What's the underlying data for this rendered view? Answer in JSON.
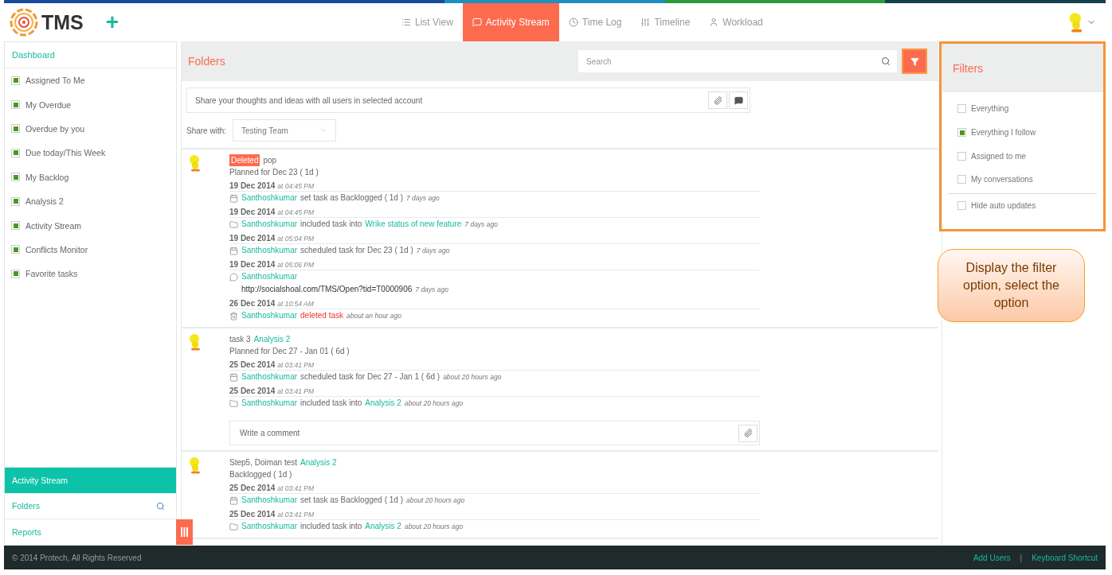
{
  "header": {
    "logo": "TMS",
    "add": "+",
    "tabs": [
      {
        "label": "List View",
        "kind": "list",
        "selected": false
      },
      {
        "label": "Activity Stream",
        "kind": "chat",
        "selected": true
      },
      {
        "label": "Time Log",
        "kind": "clock",
        "selected": false
      },
      {
        "label": "Timeline",
        "kind": "sliders",
        "selected": false
      },
      {
        "label": "Workload",
        "kind": "user",
        "selected": false
      }
    ]
  },
  "sidebar": {
    "top": "Dashboard",
    "items": [
      {
        "label": "Assigned To Me",
        "checked": true
      },
      {
        "label": "My Overdue",
        "checked": true
      },
      {
        "label": "Overdue by you",
        "checked": true
      },
      {
        "label": "Due today/This Week",
        "checked": true
      },
      {
        "label": "My Backlog",
        "checked": true
      },
      {
        "label": "Analysis 2",
        "checked": true
      },
      {
        "label": "Activity Stream",
        "checked": true
      },
      {
        "label": "Conflicts Monitor",
        "checked": true
      },
      {
        "label": "Favorite tasks",
        "checked": true
      }
    ],
    "nav": [
      {
        "label": "Activity Stream",
        "selected": true,
        "search": false
      },
      {
        "label": "Folders",
        "selected": false,
        "search": true
      },
      {
        "label": "Reports",
        "selected": false,
        "search": false
      }
    ]
  },
  "main": {
    "title": "Folders",
    "search": {
      "placeholder": "Search"
    },
    "share": {
      "placeholder": "Share your thoughts and ideas with all users in selected account",
      "label": "Share with:",
      "team": "Testing Team"
    },
    "posts": [
      {
        "title": [
          {
            "text": "Deleted",
            "kind": "badge"
          },
          {
            "text": "pop",
            "kind": "plain"
          }
        ],
        "subtitle": "Planned for Dec 23 ( 1d )",
        "events": [
          {
            "date": "19 Dec 2014",
            "time": "at 04:45 PM",
            "kind": "calendar",
            "user": "Santhoshkumar",
            "parts": [
              {
                "text": "set task as Backlogged ( 1d )",
                "kind": "plain"
              }
            ],
            "ago": "7 days ago"
          },
          {
            "date": "19 Dec 2014",
            "time": "at 04:45 PM",
            "kind": "folder",
            "user": "Santhoshkumar",
            "parts": [
              {
                "text": "included task into",
                "kind": "plain"
              },
              {
                "text": "Wrike status of new feature",
                "kind": "link"
              }
            ],
            "ago": "7 days ago"
          },
          {
            "date": "19 Dec 2014",
            "time": "at 05:04 PM",
            "kind": "calendar",
            "user": "Santhoshkumar",
            "parts": [
              {
                "text": "scheduled task for Dec 23 ( 1d )",
                "kind": "plain"
              }
            ],
            "ago": "7 days ago"
          },
          {
            "date": "19 Dec 2014",
            "time": "at 05:06 PM",
            "kind": "comment",
            "user": "Santhoshkumar",
            "body": "http://socialshoal.com/TMS/Open?tid=T0000906",
            "ago": "7 days ago"
          },
          {
            "date": "26 Dec 2014",
            "time": "at 10:54 AM",
            "kind": "trash",
            "user": "Santhoshkumar",
            "parts": [
              {
                "text": "deleted task",
                "kind": "danger"
              }
            ],
            "ago": "about an hour ago"
          }
        ]
      },
      {
        "title": [
          {
            "text": "task 3",
            "kind": "plain"
          },
          {
            "text": "Analysis 2",
            "kind": "link"
          }
        ],
        "subtitle": "Planned for Dec 27 - Jan 01 ( 6d )",
        "events": [
          {
            "date": "25 Dec 2014",
            "time": "at 03:41 PM",
            "kind": "calendar",
            "user": "Santhoshkumar",
            "parts": [
              {
                "text": "scheduled task for Dec 27 - Jan 1 ( 6d )",
                "kind": "plain"
              }
            ],
            "ago": "about 20 hours ago"
          },
          {
            "date": "25 Dec 2014",
            "time": "at 03:41 PM",
            "kind": "folder",
            "user": "Santhoshkumar",
            "parts": [
              {
                "text": "included task into",
                "kind": "plain"
              },
              {
                "text": "Analysis 2",
                "kind": "link"
              }
            ],
            "ago": "about 20 hours ago"
          }
        ],
        "comment": {
          "placeholder": "Write a comment"
        }
      },
      {
        "title": [
          {
            "text": "Step5, Doiman test",
            "kind": "plain"
          },
          {
            "text": "Analysis 2",
            "kind": "link"
          }
        ],
        "subtitle": "Backlogged ( 1d )",
        "events": [
          {
            "date": "25 Dec 2014",
            "time": "at 03:41 PM",
            "kind": "calendar",
            "user": "Santhoshkumar",
            "parts": [
              {
                "text": "set task as Backlogged ( 1d )",
                "kind": "plain"
              }
            ],
            "ago": "about 20 hours ago"
          },
          {
            "date": "25 Dec 2014",
            "time": "at 03:41 PM",
            "kind": "folder",
            "user": "Santhoshkumar",
            "parts": [
              {
                "text": "included task into",
                "kind": "plain"
              },
              {
                "text": "Analysis 2",
                "kind": "link"
              }
            ],
            "ago": "about 20 hours ago"
          }
        ]
      }
    ]
  },
  "filters": {
    "title": "Filters",
    "options": [
      {
        "label": "Everything",
        "checked": false,
        "separated": false
      },
      {
        "label": "Everything I follow",
        "checked": true,
        "separated": false
      },
      {
        "label": "Assigned to me",
        "checked": false,
        "separated": false
      },
      {
        "label": "My conversations",
        "checked": false,
        "separated": false
      },
      {
        "label": "Hide auto updates",
        "checked": false,
        "separated": true
      }
    ]
  },
  "callout": "Display the filter option, select the option",
  "footer": {
    "copyright": "© 2014 Protech, All Rights Reserved",
    "links": [
      "Add Users",
      "Keyboard Shortcut"
    ],
    "separator": "|"
  }
}
